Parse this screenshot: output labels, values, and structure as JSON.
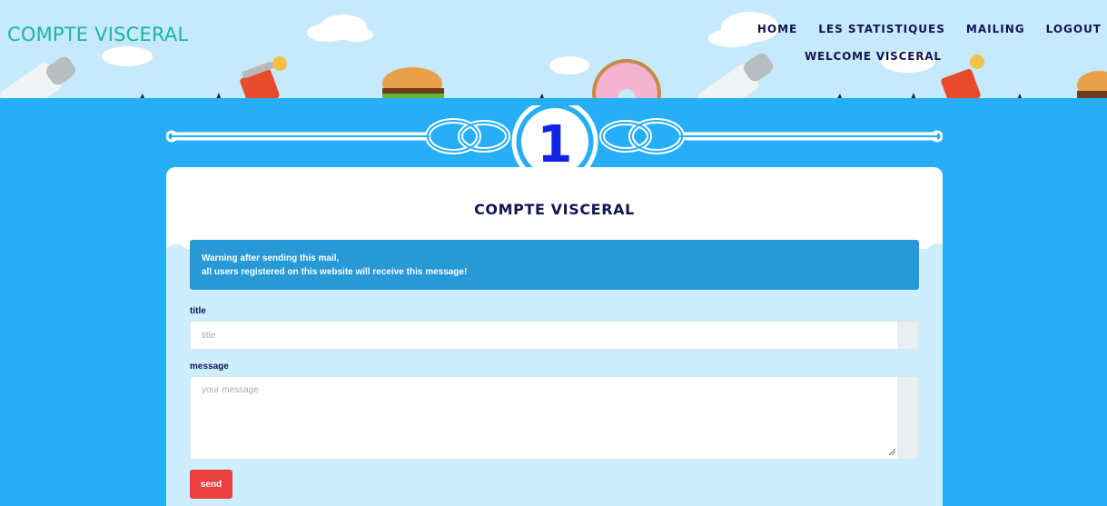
{
  "brand": "COMPTE VISCERAL",
  "nav": {
    "home": "HOME",
    "stats": "LES STATISTIQUES",
    "mailing": "MAILING",
    "logout": "LOGOUT"
  },
  "welcome": "WELCOME VISCERAL",
  "step_number": "1",
  "card": {
    "title": "COMPTE VISCERAL",
    "alert_line1": "Warning after sending this mail,",
    "alert_line2": "all users registered on this website will receive this message!"
  },
  "form": {
    "title_label": "title",
    "title_placeholder": "title",
    "message_label": "message",
    "message_placeholder": "your message",
    "send_label": "send"
  },
  "colors": {
    "sky": "#c6e9fb",
    "water": "#26aef7",
    "brand": "#19b7a1",
    "navy": "#101651",
    "alert": "#2799d6",
    "send": "#ea4040"
  }
}
